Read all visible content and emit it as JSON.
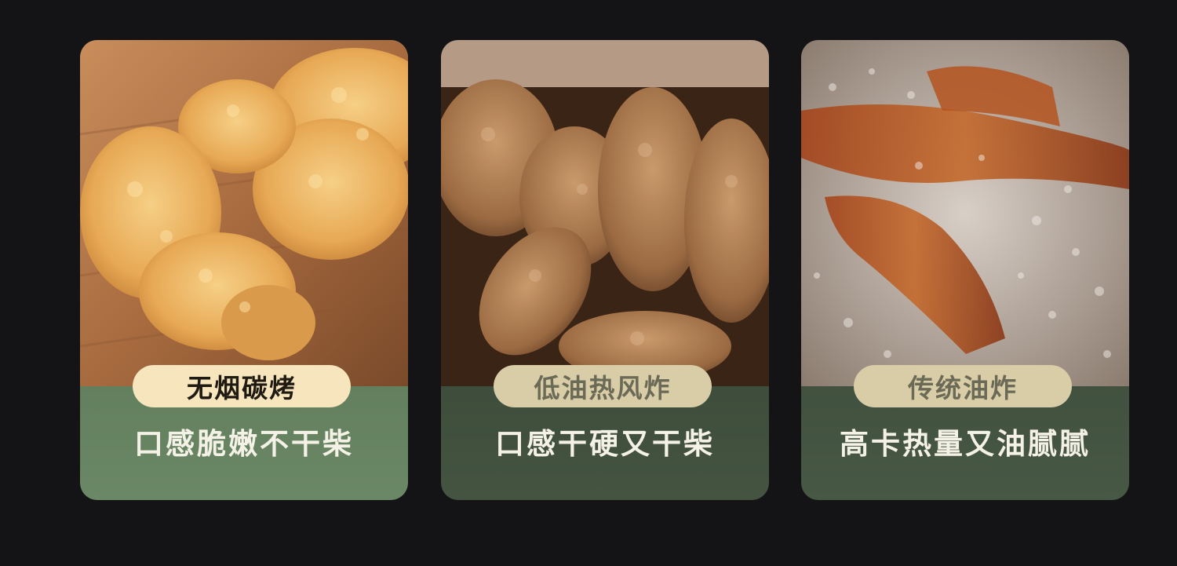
{
  "cards": [
    {
      "label": "无烟碳烤",
      "description": "口感脆嫩不干柴"
    },
    {
      "label": "低油热风炸",
      "description": "口感干硬又干柴"
    },
    {
      "label": "传统油炸",
      "description": "高卡热量又油腻腻"
    }
  ],
  "colors": {
    "background": "#141416",
    "card_green_light": "#5e7a58",
    "card_green_dark": "#3b4a38",
    "pill_highlight": "#f7e5bd",
    "pill_muted": "#d9cda8",
    "text_light": "#f4f1e6"
  }
}
